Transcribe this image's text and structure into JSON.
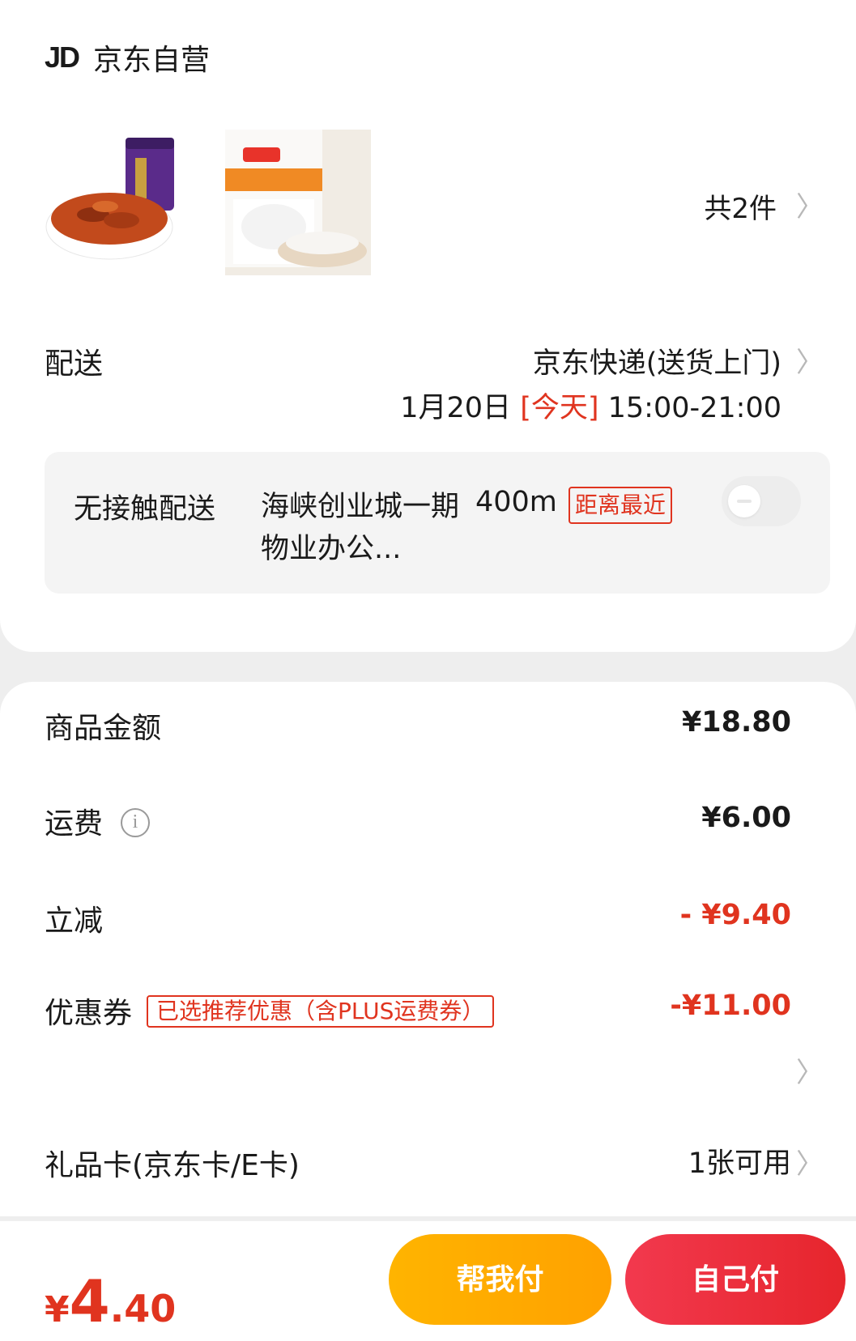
{
  "store": {
    "logo": "JD",
    "name": "京东自营"
  },
  "items": {
    "count_label": "共2件"
  },
  "delivery": {
    "label": "配送",
    "method": "京东快递(送货上门)",
    "date": "1月20日",
    "today": "[今天]",
    "time": "15:00-21:00"
  },
  "contactless": {
    "label": "无接触配送",
    "address": "海峡创业城一期物业办公...",
    "distance": "400m",
    "badge": "距离最近",
    "toggle_on": false
  },
  "summary": {
    "goods_label": "商品金额",
    "goods_value": "¥18.80",
    "shipping_label": "运费",
    "shipping_value": "¥6.00",
    "discount_label": "立减",
    "discount_value": "- ¥9.40",
    "coupon_label": "优惠券",
    "coupon_badge": "已选推荐优惠（含PLUS运费券）",
    "coupon_value": "-¥11.00",
    "giftcard_label": "礼品卡(京东卡/E卡)",
    "giftcard_value": "1张可用"
  },
  "footer": {
    "currency": "¥",
    "total_int": "4",
    "total_dec": ".40",
    "help_pay": "帮我付",
    "self_pay": "自己付"
  },
  "colors": {
    "accent_red": "#e0341f",
    "help_btn": "#ffa100",
    "pay_btn": "#e6252c"
  }
}
